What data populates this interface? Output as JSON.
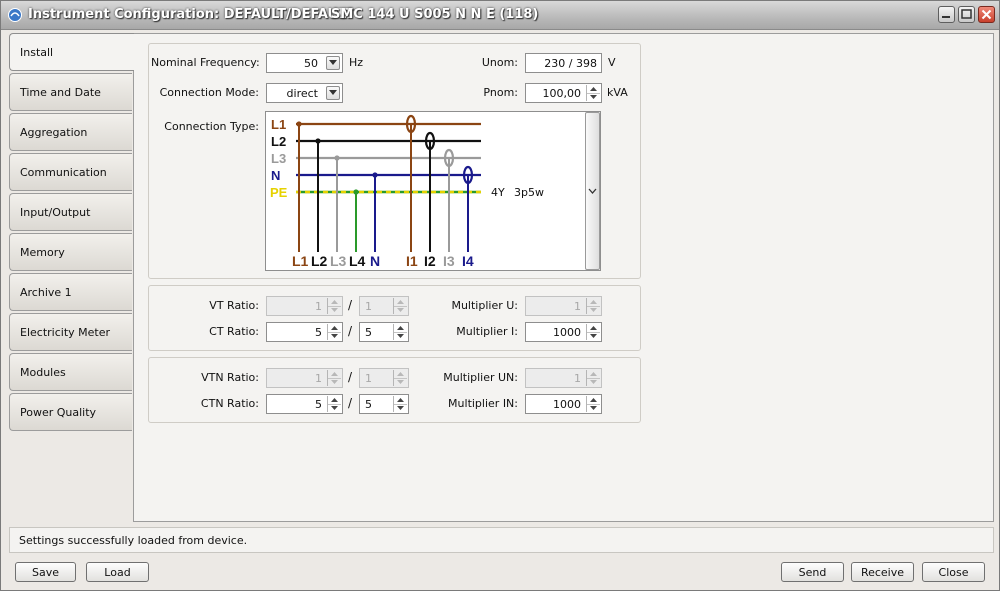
{
  "window": {
    "title": "Instrument Configuration: DEFAULT/DEFAULT",
    "device": "SMC 144 U S005 N N E (118)"
  },
  "tabs": [
    {
      "label": "Install",
      "active": true
    },
    {
      "label": "Time and Date"
    },
    {
      "label": "Aggregation"
    },
    {
      "label": "Communication"
    },
    {
      "label": "Input/Output"
    },
    {
      "label": "Memory"
    },
    {
      "label": "Archive 1"
    },
    {
      "label": "Electricity Meter"
    },
    {
      "label": "Modules"
    },
    {
      "label": "Power Quality"
    }
  ],
  "install": {
    "nominal_frequency": {
      "label": "Nominal Frequency:",
      "value": "50",
      "unit": "Hz"
    },
    "connection_mode": {
      "label": "Connection Mode:",
      "value": "direct"
    },
    "connection_type": {
      "label": "Connection Type:",
      "code": "4Y",
      "name": "3p5w"
    },
    "unom": {
      "label": "Unom:",
      "value": "230 / 398",
      "unit": "V"
    },
    "pnom": {
      "label": "Pnom:",
      "value": "100,00",
      "unit": "kVA"
    },
    "diagram": {
      "lines": [
        "L1",
        "L2",
        "L3",
        "N",
        "PE"
      ],
      "terminals": [
        "L1",
        "L2",
        "L3",
        "L4",
        "N",
        "I1",
        "I2",
        "I3",
        "I4"
      ],
      "colors": {
        "L1": "#8b4513",
        "L2": "#111111",
        "L3": "#9a9a9a",
        "N": "#1a1a8c",
        "PE_yellow": "#e6d200",
        "PE_green": "#2a9a2a"
      }
    },
    "vt_ratio": {
      "label": "VT Ratio:",
      "primary": "1",
      "secondary": "1",
      "enabled": false
    },
    "ct_ratio": {
      "label": "CT Ratio:",
      "primary": "5",
      "secondary": "5"
    },
    "multiplier_u": {
      "label": "Multiplier U:",
      "value": "1",
      "enabled": false
    },
    "multiplier_i": {
      "label": "Multiplier I:",
      "value": "1000"
    },
    "vtn_ratio": {
      "label": "VTN Ratio:",
      "primary": "1",
      "secondary": "1",
      "enabled": false
    },
    "ctn_ratio": {
      "label": "CTN Ratio:",
      "primary": "5",
      "secondary": "5"
    },
    "multiplier_un": {
      "label": "Multiplier UN:",
      "value": "1",
      "enabled": false
    },
    "multiplier_in": {
      "label": "Multiplier IN:",
      "value": "1000"
    },
    "slash": "/"
  },
  "status": "Settings successfully loaded from device.",
  "buttons": {
    "save": "Save",
    "load": "Load",
    "send": "Send",
    "receive": "Receive",
    "close": "Close"
  }
}
